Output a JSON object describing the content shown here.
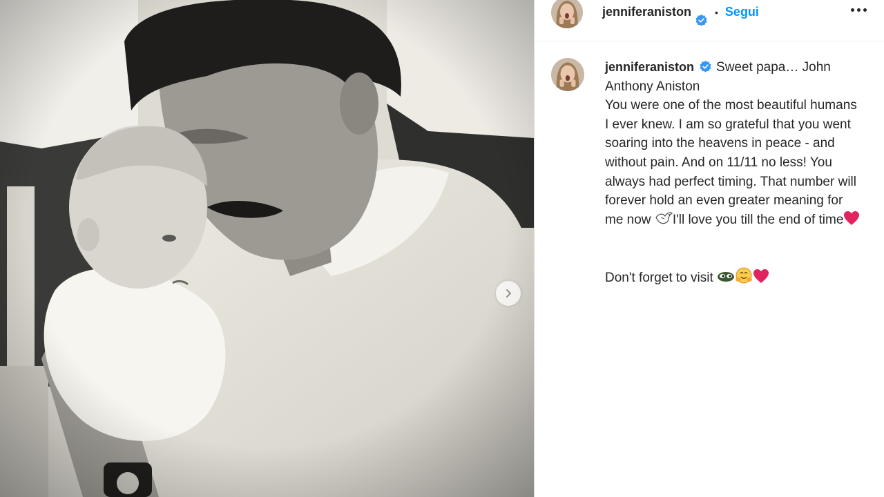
{
  "post": {
    "username": "jenniferaniston",
    "follow_label": "Segui",
    "separator": "•",
    "caption_lead": "Sweet papa… John Anthony Aniston\nYou were one of the most beautiful humans I ever knew. I am so grateful that you went soaring into the heavens in peace - and without pain. And on 11/11 no less! You always had perfect timing. That number will forever hold an even greater meaning for me now ",
    "caption_mid": "I'll love you till the end of time",
    "caption_visit": "Don't forget to visit "
  },
  "icons": {
    "verified": "verified-badge-icon",
    "more": "more-options-icon",
    "next": "chevron-right-icon",
    "dove": "dove-emoji",
    "heart": "red-heart-emoji",
    "eyes": "eyes-emoji",
    "hug": "hugging-face-emoji"
  },
  "colors": {
    "accent": "#0095f6",
    "verified": "#3897f0",
    "heart": "#e0245e"
  }
}
